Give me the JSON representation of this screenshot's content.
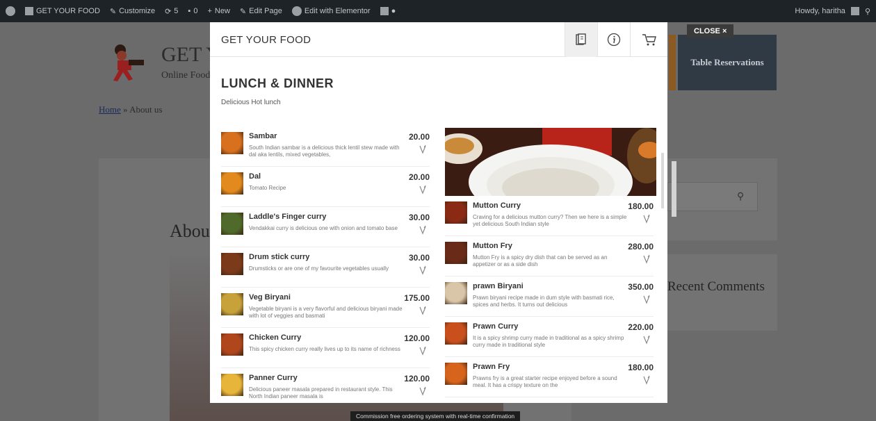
{
  "adminbar": {
    "site": "GET YOUR FOOD",
    "customize": "Customize",
    "updates": "5",
    "comments": "0",
    "new": "New",
    "edit_page": "Edit Page",
    "edit_elementor": "Edit with Elementor",
    "howdy": "Howdy, haritha"
  },
  "site": {
    "title": "GET YOUR FOOD",
    "tagline": "Online Food",
    "breadcrumb_home": "Home",
    "breadcrumb_sep": "»",
    "breadcrumb_current": "About us",
    "page_title": "About us",
    "comments_title": "Recent Comments",
    "reserve_button": "Table Reservations",
    "close_button": "CLOSE ×"
  },
  "modal": {
    "brand": "GET YOUR FOOD",
    "section_title": "LUNCH & DINNER",
    "section_subtitle": "Delicious Hot lunch"
  },
  "left_items": [
    {
      "name": "Sambar",
      "price": "20.00",
      "desc": "South Indian sambar is a delicious thick lentil stew made with dal aka lentils, mixed vegetables,"
    },
    {
      "name": "Dal",
      "price": "20.00",
      "desc": "Tomato Recipe"
    },
    {
      "name": "Laddle's Finger curry",
      "price": "30.00",
      "desc": "Vendakkai curry is delicious one with onion and tomato base"
    },
    {
      "name": "Drum stick curry",
      "price": "30.00",
      "desc": "Drumsticks or are one of my favourite vegetables usually"
    },
    {
      "name": "Veg Biryani",
      "price": "175.00",
      "desc": "Vegetable biryani is a very flavorful and delicious biryani made with lot of veggies and basmati"
    },
    {
      "name": "Chicken Curry",
      "price": "120.00",
      "desc": "This spicy chicken curry really lives up to its name of richness"
    },
    {
      "name": "Panner Curry",
      "price": "120.00",
      "desc": "Delicious paneer masala prepared in restaurant style. This North Indian paneer masala is"
    }
  ],
  "right_items": [
    {
      "name": "Mutton Curry",
      "price": "180.00",
      "desc": "Craving for a delicious mutton curry? Then we here is a simple yet delicious South Indian style"
    },
    {
      "name": "Mutton Fry",
      "price": "280.00",
      "desc": "Mutton Fry is a spicy dry dish that can be served as an appetizer or as a side dish"
    },
    {
      "name": "prawn Biryani",
      "price": "350.00",
      "desc": "Prawn biryani recipe made in dum style with basmati rice, spices and herbs. It turns out delicious"
    },
    {
      "name": "Prawn Curry",
      "price": "220.00",
      "desc": "It is a spicy shrimp curry made in traditional as a spicy shrimp curry made in traditional style"
    },
    {
      "name": "Prawn Fry",
      "price": "180.00",
      "desc": "Prawns fry is a great starter recipe enjoyed before a sound meal. It has a crispy texture on the"
    }
  ],
  "toast": "Commission free ordering system with real-time confirmation",
  "icons": {
    "menu": "menu-book-icon",
    "info": "info-icon",
    "cart": "cart-icon",
    "veg": "veg-leaf-icon",
    "search": "search-icon"
  },
  "colors": {
    "overlay": "#6f6f6f",
    "adminbar": "#1d2327",
    "reserve": "#2f3a45",
    "text": "#333333"
  }
}
